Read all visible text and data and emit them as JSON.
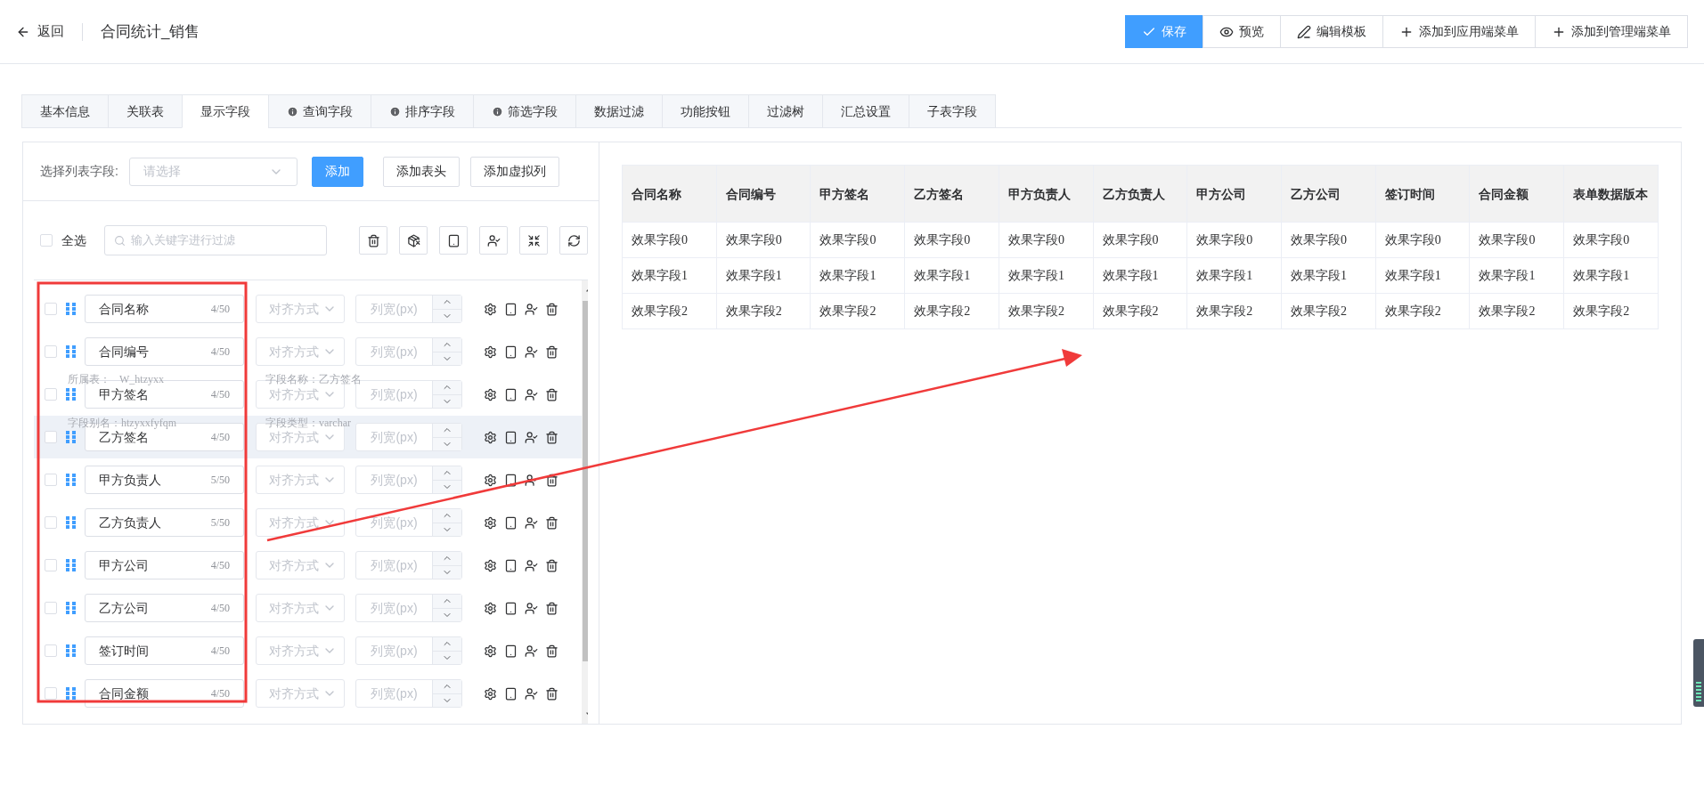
{
  "header": {
    "back_label": "返回",
    "title": "合同统计_销售",
    "actions": [
      {
        "label": "保存",
        "kind": "save"
      },
      {
        "label": "预览",
        "kind": "preview"
      },
      {
        "label": "编辑模板",
        "kind": "template"
      },
      {
        "label": "添加到应用端菜单",
        "kind": "add"
      },
      {
        "label": "添加到管理端菜单",
        "kind": "add"
      }
    ]
  },
  "tabs": [
    {
      "label": "基本信息",
      "selected": false,
      "info": false
    },
    {
      "label": "关联表",
      "selected": false,
      "info": false
    },
    {
      "label": "显示字段",
      "selected": true,
      "info": false
    },
    {
      "label": "查询字段",
      "selected": false,
      "info": true
    },
    {
      "label": "排序字段",
      "selected": false,
      "info": true
    },
    {
      "label": "筛选字段",
      "selected": false,
      "info": true
    },
    {
      "label": "数据过滤",
      "selected": false,
      "info": false
    },
    {
      "label": "功能按钮",
      "selected": false,
      "info": false
    },
    {
      "label": "过滤树",
      "selected": false,
      "info": false
    },
    {
      "label": "汇总设置",
      "selected": false,
      "info": false
    },
    {
      "label": "子表字段",
      "selected": false,
      "info": false
    }
  ],
  "field_picker": {
    "label": "选择列表字段:",
    "placeholder": "请选择",
    "buttons": [
      {
        "label": "添加",
        "kind": "primary"
      },
      {
        "label": "添加表头",
        "kind": "default"
      },
      {
        "label": "添加虚拟列",
        "kind": "default"
      }
    ]
  },
  "filter": {
    "select_all": {
      "label": "全选",
      "checked": false
    },
    "placeholder": "输入关键字进行过滤"
  },
  "fields": [
    {
      "name": "合同名称",
      "count": "4/50",
      "checked": false,
      "highlighted": false,
      "align_placeholder": "对齐方式",
      "width_placeholder": "列宽(px)"
    },
    {
      "name": "合同编号",
      "count": "4/50",
      "checked": false,
      "highlighted": false,
      "align_placeholder": "对齐方式",
      "width_placeholder": "列宽(px)"
    },
    {
      "name": "甲方签名",
      "count": "4/50",
      "checked": false,
      "highlighted": false,
      "align_placeholder": "对齐方式",
      "width_placeholder": "列宽(px)"
    },
    {
      "name": "乙方签名",
      "count": "4/50",
      "checked": false,
      "highlighted": true,
      "align_placeholder": "对齐方式",
      "width_placeholder": "列宽(px)"
    },
    {
      "name": "甲方负责人",
      "count": "5/50",
      "checked": false,
      "highlighted": false,
      "align_placeholder": "对齐方式",
      "width_placeholder": "列宽(px)"
    },
    {
      "name": "乙方负责人",
      "count": "5/50",
      "checked": false,
      "highlighted": false,
      "align_placeholder": "对齐方式",
      "width_placeholder": "列宽(px)"
    },
    {
      "name": "甲方公司",
      "count": "4/50",
      "checked": false,
      "highlighted": false,
      "align_placeholder": "对齐方式",
      "width_placeholder": "列宽(px)"
    },
    {
      "name": "乙方公司",
      "count": "4/50",
      "checked": false,
      "highlighted": false,
      "align_placeholder": "对齐方式",
      "width_placeholder": "列宽(px)"
    },
    {
      "name": "签订时间",
      "count": "4/50",
      "checked": false,
      "highlighted": false,
      "align_placeholder": "对齐方式",
      "width_placeholder": "列宽(px)"
    },
    {
      "name": "合同金额",
      "count": "4/50",
      "checked": false,
      "highlighted": false,
      "align_placeholder": "对齐方式",
      "width_placeholder": "列宽(px)"
    }
  ],
  "tooltip": {
    "table_label": "所属表：",
    "table": "W_htzyxx",
    "field_name": "字段名称：乙方签名",
    "alias": "字段别名：htzyxxfyfqm",
    "type": "字段类型：varchar"
  },
  "preview_table": {
    "columns": [
      "合同名称",
      "合同编号",
      "甲方签名",
      "乙方签名",
      "甲方负责人",
      "乙方负责人",
      "甲方公司",
      "乙方公司",
      "签订时间",
      "合同金额",
      "表单数据版本"
    ],
    "rows": [
      [
        "效果字段0",
        "效果字段0",
        "效果字段0",
        "效果字段0",
        "效果字段0",
        "效果字段0",
        "效果字段0",
        "效果字段0",
        "效果字段0",
        "效果字段0",
        "效果字段0"
      ],
      [
        "效果字段1",
        "效果字段1",
        "效果字段1",
        "效果字段1",
        "效果字段1",
        "效果字段1",
        "效果字段1",
        "效果字段1",
        "效果字段1",
        "效果字段1",
        "效果字段1"
      ],
      [
        "效果字段2",
        "效果字段2",
        "效果字段2",
        "效果字段2",
        "效果字段2",
        "效果字段2",
        "效果字段2",
        "效果字段2",
        "效果字段2",
        "效果字段2",
        "效果字段2"
      ]
    ]
  }
}
